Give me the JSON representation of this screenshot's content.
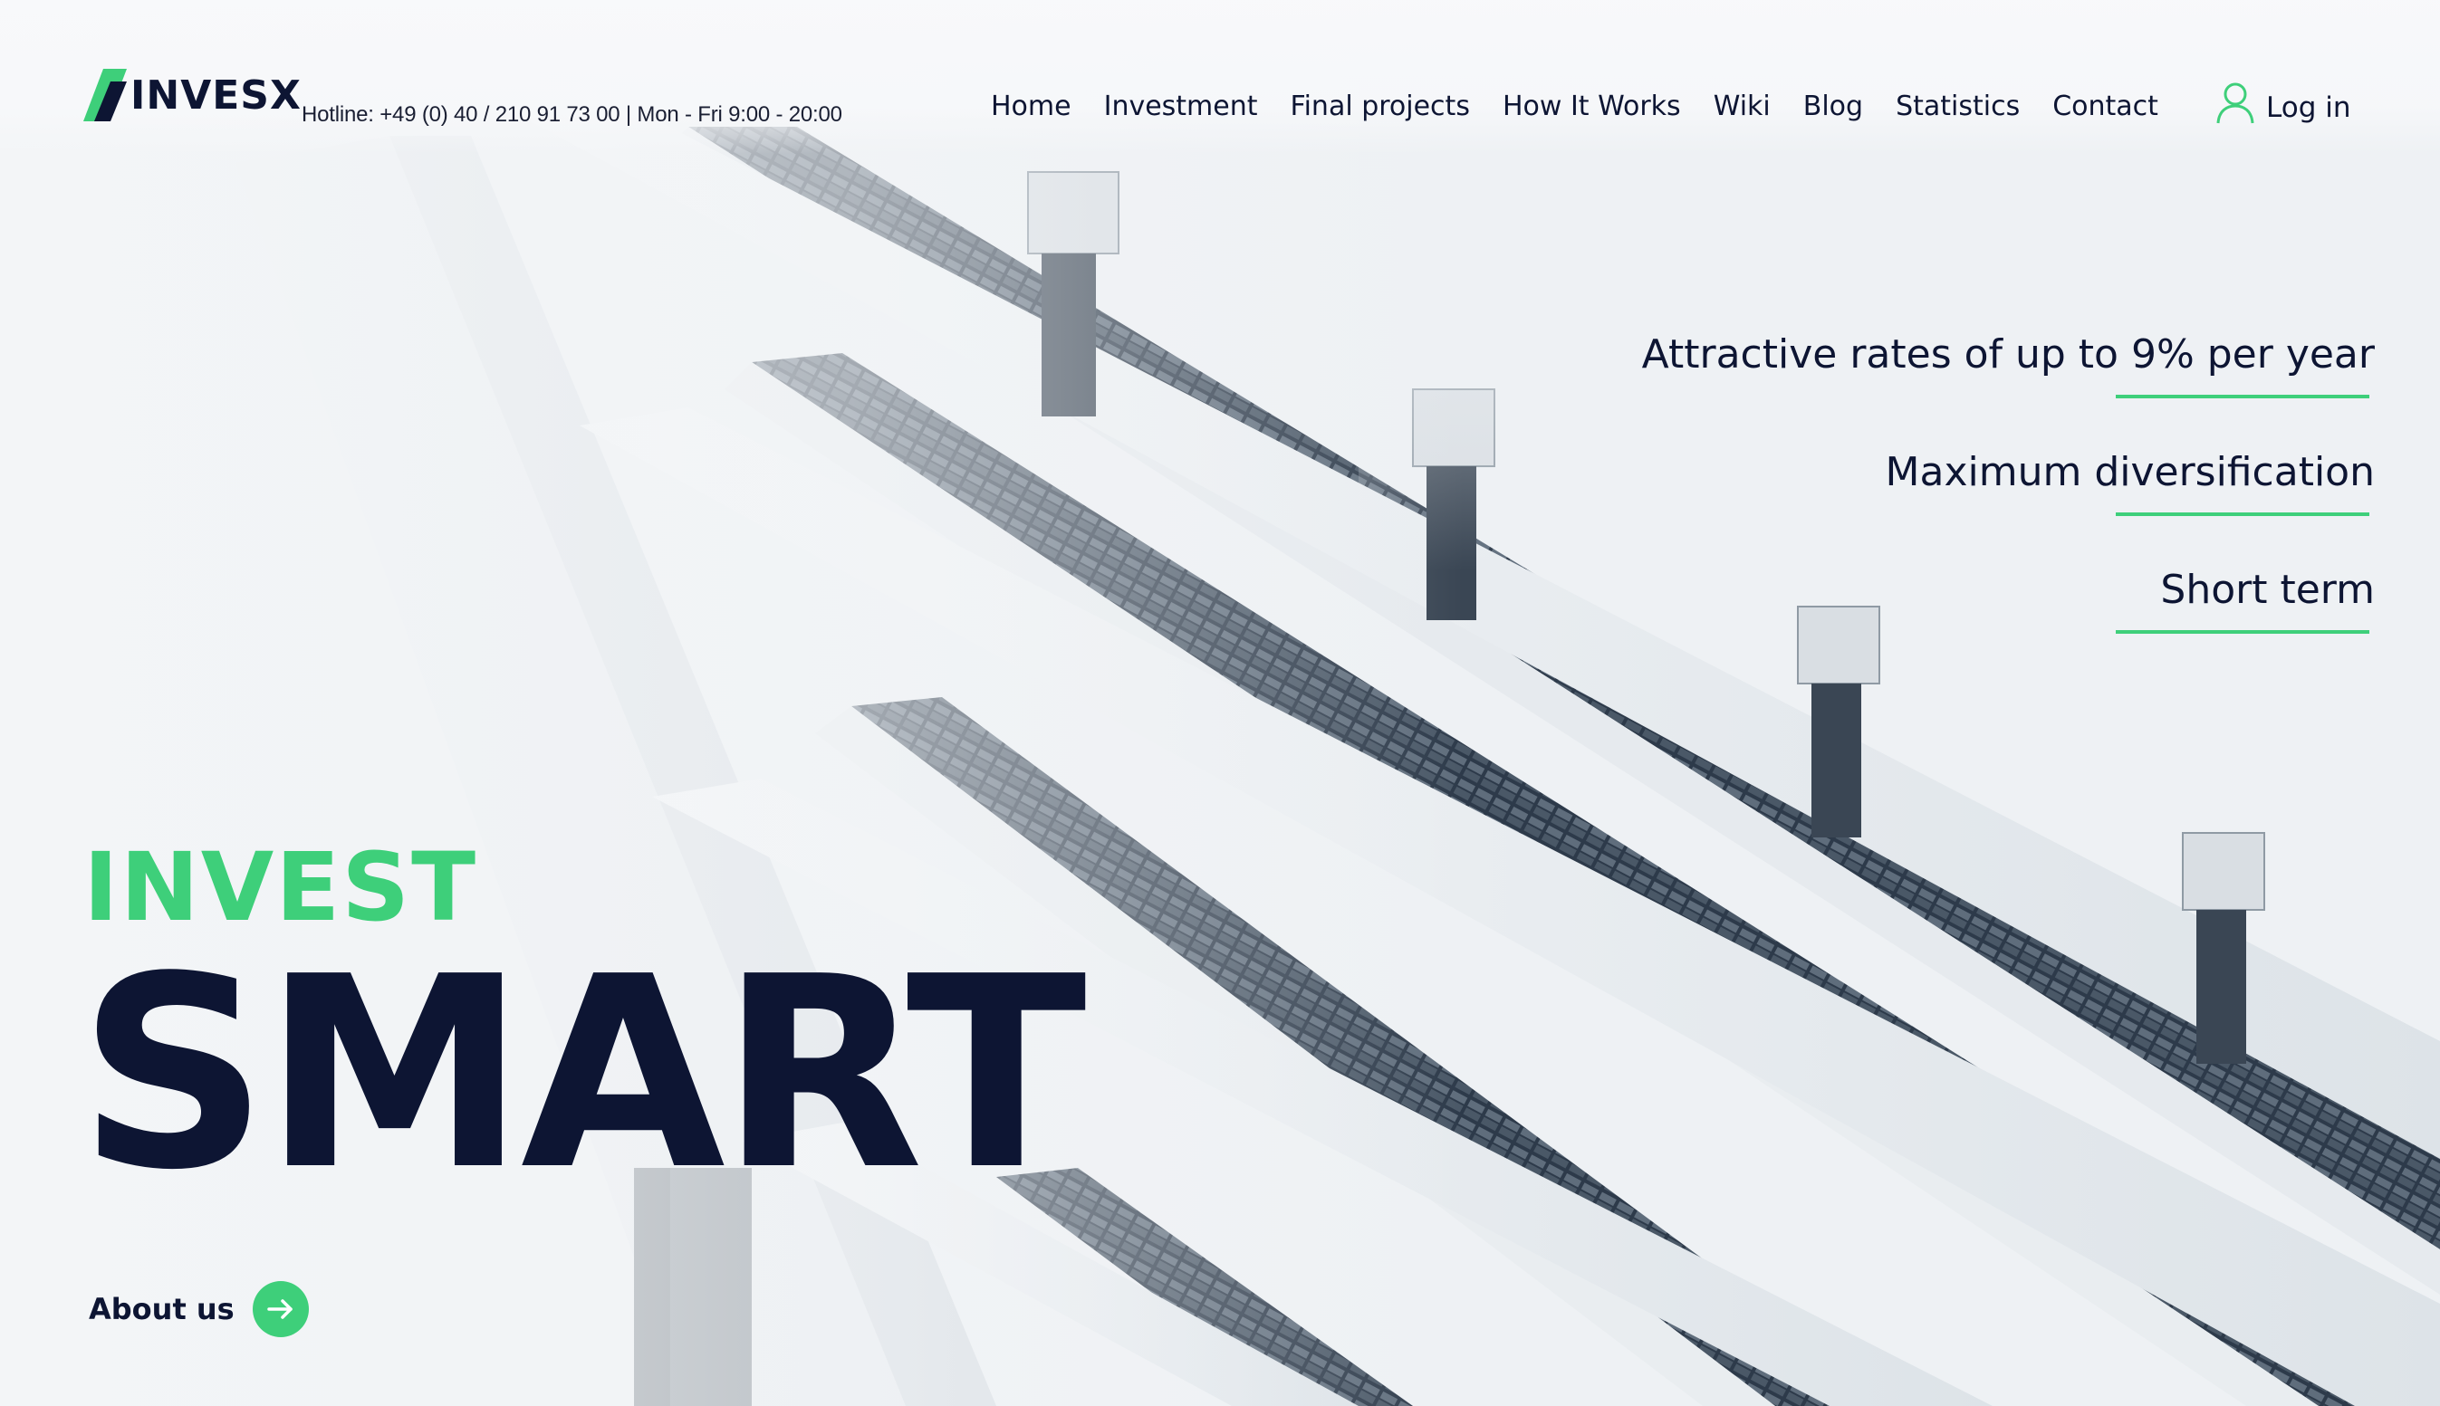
{
  "brand": {
    "name": "INVESX",
    "hotline": "Hotline: +49 (0) 40 / 210 91 73 00 | Mon - Fri 9:00 - 20:00"
  },
  "nav": {
    "items": [
      {
        "label": "Home"
      },
      {
        "label": "Investment"
      },
      {
        "label": "Final projects"
      },
      {
        "label": "How It Works"
      },
      {
        "label": "Wiki"
      },
      {
        "label": "Blog"
      },
      {
        "label": "Statistics"
      },
      {
        "label": "Contact"
      }
    ],
    "login_label": "Log in"
  },
  "features": [
    {
      "text": "Attractive rates of up to 9% per year"
    },
    {
      "text": "Maximum diversification"
    },
    {
      "text": "Short term"
    }
  ],
  "hero": {
    "eyebrow": "INVEST",
    "headline": "SMART"
  },
  "about": {
    "label": "About us"
  },
  "icons": {
    "logo": "invesx-logo-mark",
    "login": "user-icon",
    "about": "arrow-right-icon"
  },
  "colors": {
    "accent": "#3ecf7a",
    "dark": "#0d1533",
    "background": "#f3f5f7"
  }
}
